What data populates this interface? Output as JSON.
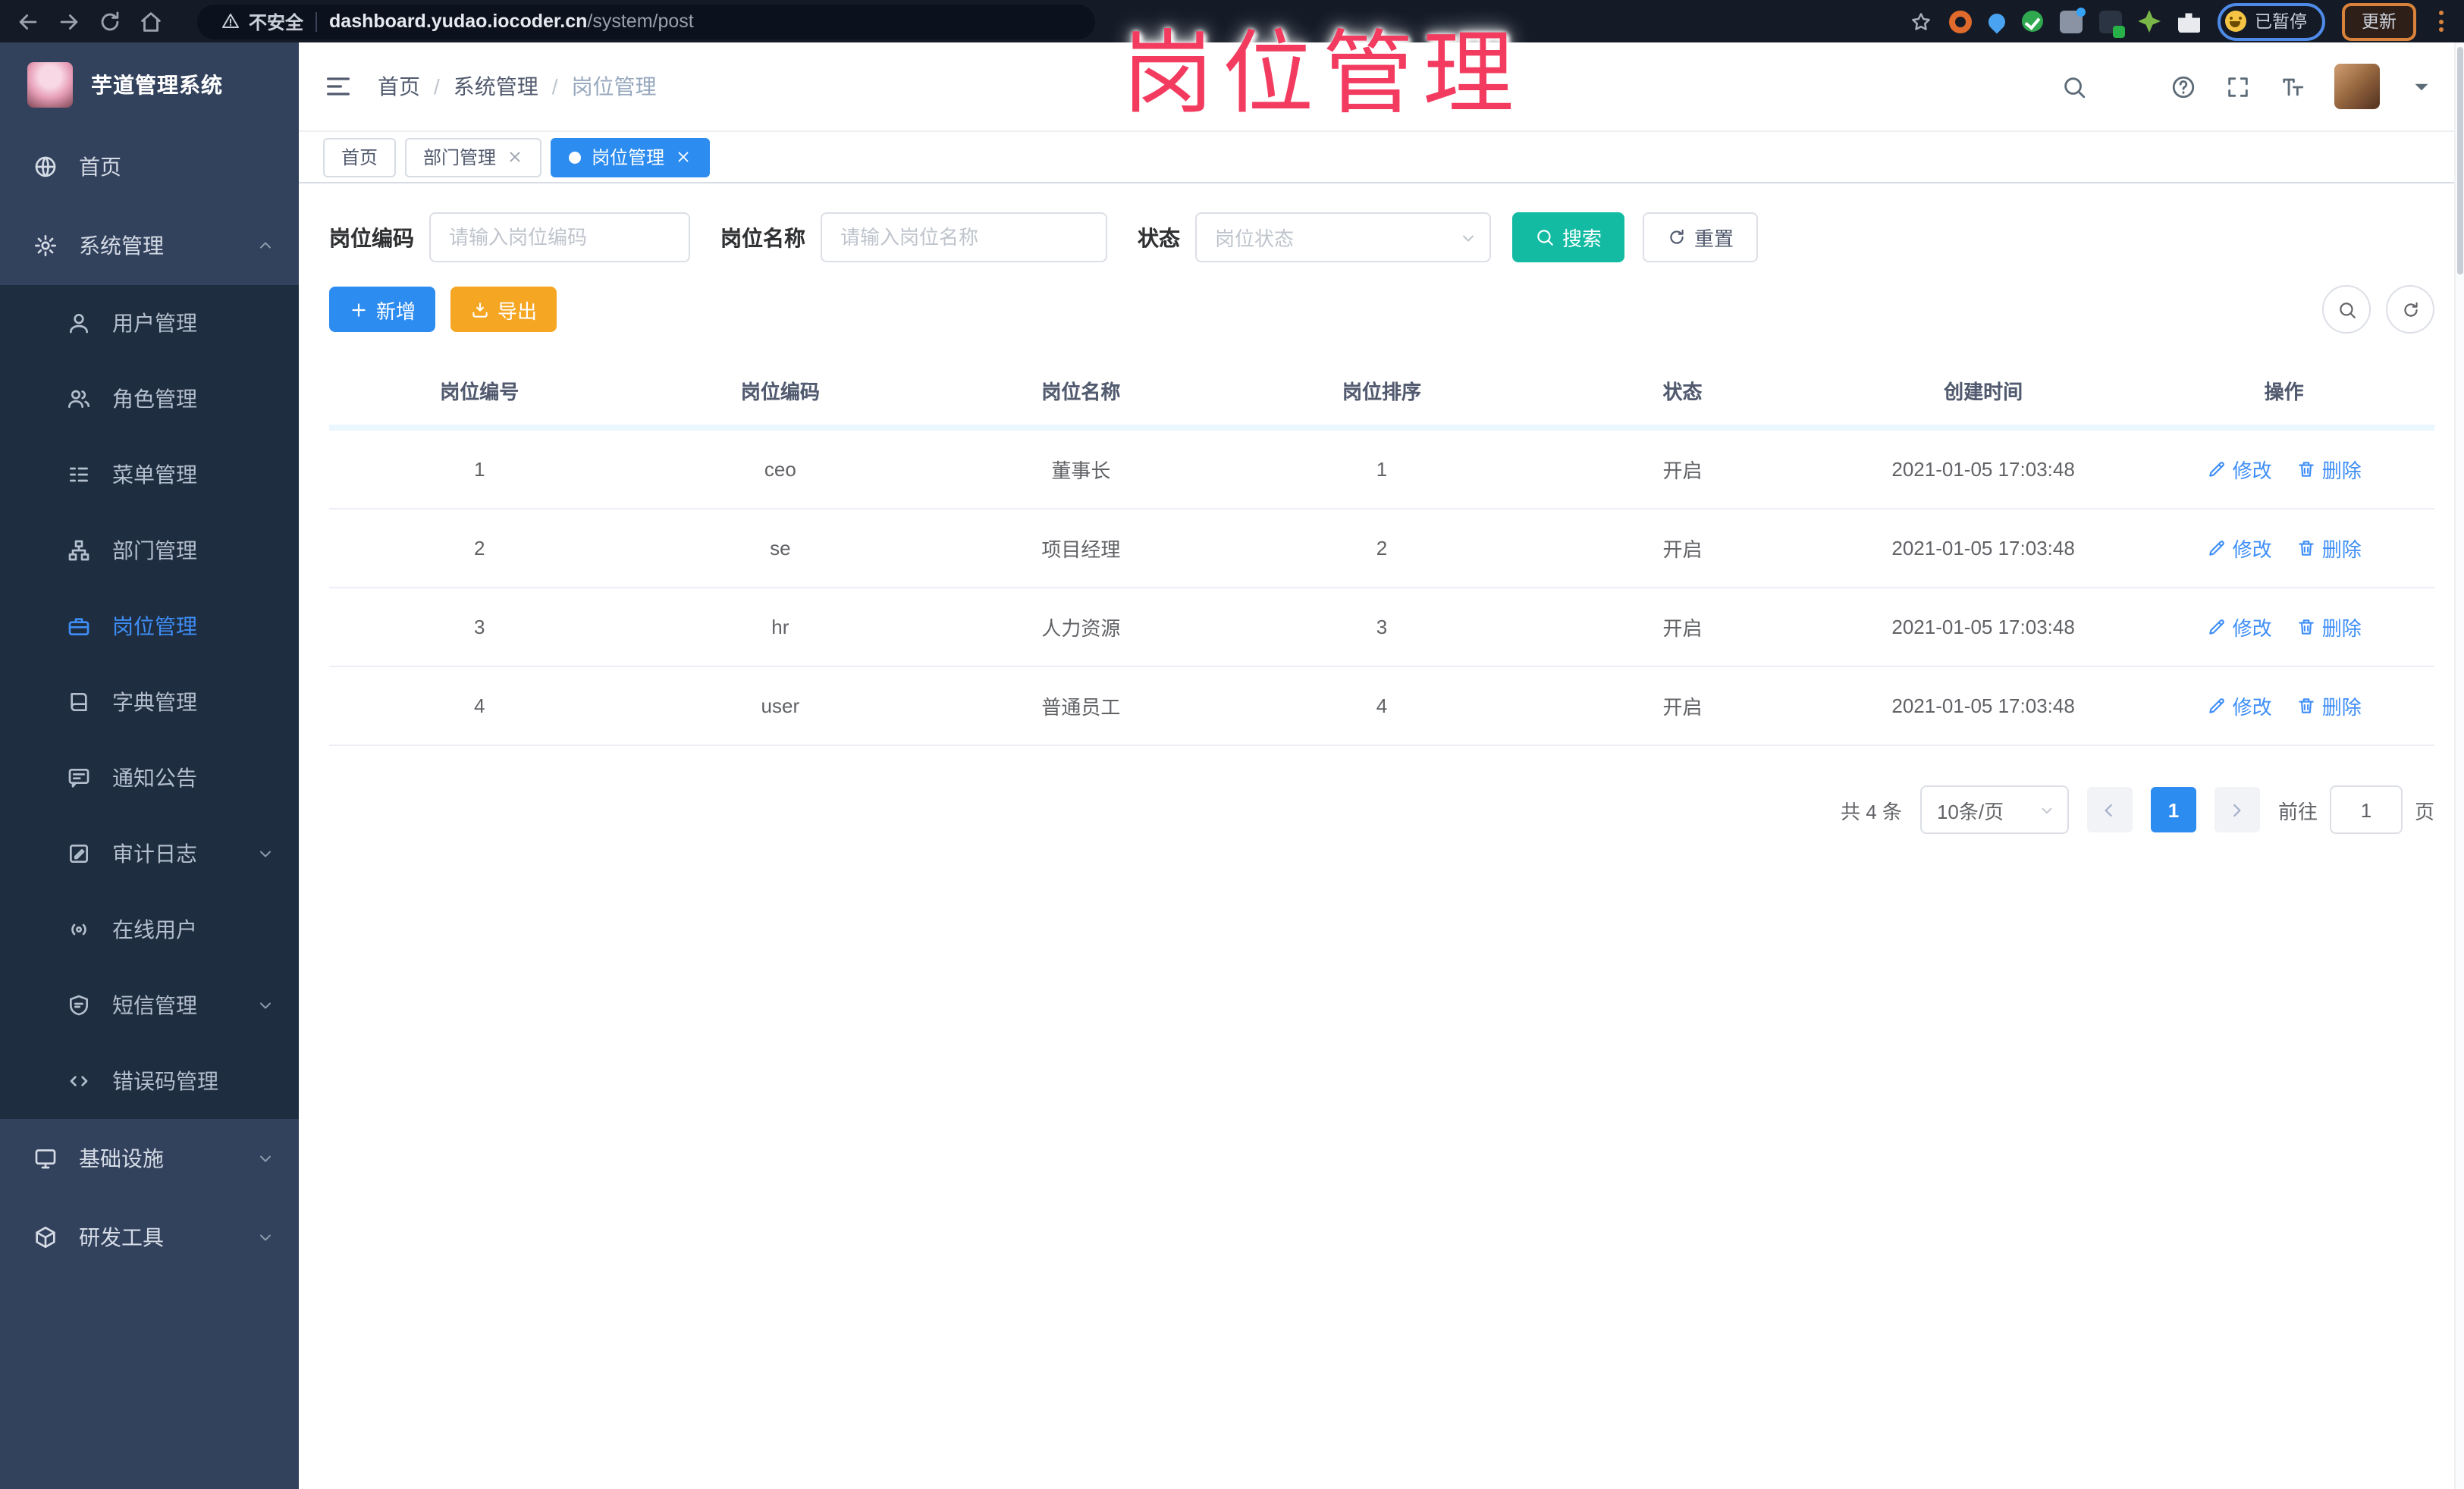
{
  "browser": {
    "security_label": "不安全",
    "url_host": "dashboard.yudao.iocoder.cn",
    "url_path": "/system/post",
    "paused_label": "已暂停",
    "update_label": "更新"
  },
  "annotation": {
    "text": "岗位管理",
    "color": "#F23B5F"
  },
  "sidebar": {
    "title": "芋道管理系统",
    "items": [
      {
        "id": "home",
        "label": "首页",
        "icon": "dashboard-icon",
        "level": "top"
      },
      {
        "id": "system",
        "label": "系统管理",
        "icon": "gear-icon",
        "level": "top",
        "chevron": "up"
      },
      {
        "id": "user",
        "label": "用户管理",
        "icon": "user-icon",
        "level": "sub"
      },
      {
        "id": "role",
        "label": "角色管理",
        "icon": "users-icon",
        "level": "sub"
      },
      {
        "id": "menu",
        "label": "菜单管理",
        "icon": "menu-list-icon",
        "level": "sub"
      },
      {
        "id": "dept",
        "label": "部门管理",
        "icon": "org-tree-icon",
        "level": "sub"
      },
      {
        "id": "post",
        "label": "岗位管理",
        "icon": "briefcase-icon",
        "level": "sub",
        "active": true
      },
      {
        "id": "dict",
        "label": "字典管理",
        "icon": "book-icon",
        "level": "sub"
      },
      {
        "id": "notice",
        "label": "通知公告",
        "icon": "announcement-icon",
        "level": "sub"
      },
      {
        "id": "audit",
        "label": "审计日志",
        "icon": "edit-log-icon",
        "level": "sub",
        "chevron": "down"
      },
      {
        "id": "online",
        "label": "在线用户",
        "icon": "broadcast-icon",
        "level": "sub"
      },
      {
        "id": "sms",
        "label": "短信管理",
        "icon": "shield-message-icon",
        "level": "sub",
        "chevron": "down"
      },
      {
        "id": "errcode",
        "label": "错误码管理",
        "icon": "code-icon",
        "level": "sub"
      },
      {
        "id": "infra",
        "label": "基础设施",
        "icon": "monitor-icon",
        "level": "top",
        "chevron": "down"
      },
      {
        "id": "devtools",
        "label": "研发工具",
        "icon": "toolbox-icon",
        "level": "top",
        "chevron": "down"
      }
    ]
  },
  "header": {
    "breadcrumb": [
      "首页",
      "系统管理",
      "岗位管理"
    ]
  },
  "tabs": [
    {
      "label": "首页",
      "closable": false,
      "active": false
    },
    {
      "label": "部门管理",
      "closable": true,
      "active": false
    },
    {
      "label": "岗位管理",
      "closable": true,
      "active": true
    }
  ],
  "filters": {
    "post_code": {
      "label": "岗位编码",
      "placeholder": "请输入岗位编码"
    },
    "post_name": {
      "label": "岗位名称",
      "placeholder": "请输入岗位名称"
    },
    "status": {
      "label": "状态",
      "placeholder": "岗位状态"
    },
    "search_label": "搜索",
    "reset_label": "重置"
  },
  "toolbar": {
    "add_label": "新增",
    "export_label": "导出"
  },
  "table": {
    "columns": [
      "岗位编号",
      "岗位编码",
      "岗位名称",
      "岗位排序",
      "状态",
      "创建时间",
      "操作"
    ],
    "edit_label": "修改",
    "delete_label": "删除",
    "rows": [
      {
        "id": "1",
        "code": "ceo",
        "name": "董事长",
        "sort": "1",
        "status": "开启",
        "created": "2021-01-05 17:03:48"
      },
      {
        "id": "2",
        "code": "se",
        "name": "项目经理",
        "sort": "2",
        "status": "开启",
        "created": "2021-01-05 17:03:48"
      },
      {
        "id": "3",
        "code": "hr",
        "name": "人力资源",
        "sort": "3",
        "status": "开启",
        "created": "2021-01-05 17:03:48"
      },
      {
        "id": "4",
        "code": "user",
        "name": "普通员工",
        "sort": "4",
        "status": "开启",
        "created": "2021-01-05 17:03:48"
      }
    ]
  },
  "pagination": {
    "total_label": "共 4 条",
    "page_size": "10条/页",
    "current_page": "1",
    "goto_label": "前往",
    "goto_value": "1",
    "page_unit": "页"
  },
  "colors": {
    "primary": "#2D8CF0",
    "success_teal": "#12BBA2",
    "warning": "#F5A623",
    "sidebar": "#32415C",
    "annotation": "#F23B5F"
  }
}
